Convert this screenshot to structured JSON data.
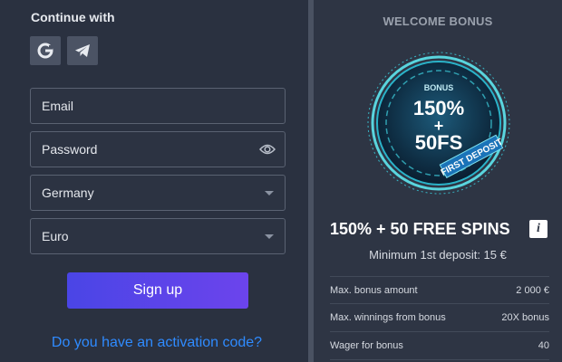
{
  "left": {
    "continue_title": "Continue with",
    "social": [
      {
        "icon": "google-icon"
      },
      {
        "icon": "telegram-icon"
      }
    ],
    "email_placeholder": "Email",
    "password_placeholder": "Password",
    "country": "Germany",
    "currency": "Euro",
    "signup_label": "Sign up",
    "activation_link": "Do you have an activation code?"
  },
  "right": {
    "welcome_title": "WELCOME BONUS",
    "badge": {
      "small": "BONUS",
      "line1": "150%",
      "plus": "+",
      "line2": "50FS",
      "ribbon": "FIRST DEPOSIT"
    },
    "offer_title": "150% + 50 FREE SPINS",
    "info_icon": "info-icon",
    "min_deposit": "Minimum 1st deposit: 15 €",
    "rows": [
      {
        "label": "Max. bonus amount",
        "value": "2 000 €"
      },
      {
        "label": "Max. winnings from bonus",
        "value": "20X bonus"
      },
      {
        "label": "Wager for bonus",
        "value": "40"
      }
    ]
  },
  "colors": {
    "accent_button_start": "#4a45e6",
    "accent_button_end": "#6c44ec",
    "link": "#2f8bff",
    "badge_glow": "#39d6e6"
  }
}
